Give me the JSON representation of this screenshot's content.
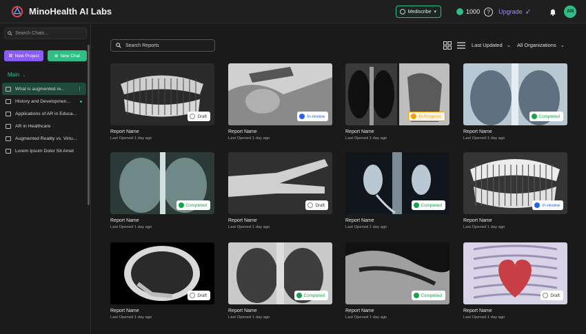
{
  "app": {
    "title": "MinoHealth AI Labs"
  },
  "topbar": {
    "product": "Mediscribe",
    "credits": "1000",
    "help": "?",
    "upgrade": "Upgrade",
    "avatar": "AN"
  },
  "sidebar": {
    "search_placeholder": "Search Chats...",
    "new_project": "New Project",
    "new_chat": "New Chat",
    "section": "Main",
    "items": [
      {
        "label": "What is augmented re..."
      },
      {
        "label": "History and Developmen..."
      },
      {
        "label": "Applications of AR in Educa..."
      },
      {
        "label": "AR in Healthcare"
      },
      {
        "label": "Augmented Reality vs. Virtu..."
      },
      {
        "label": "Lorem Ipsum Dolor Sit Amet"
      }
    ]
  },
  "toolbar": {
    "search_placeholder": "Search Reports",
    "sort": "Last Updated",
    "org": "All Organizations"
  },
  "status_colors": {
    "Draft": "#888888",
    "In-review": "#2563eb",
    "In-Progress": "#f59e0b",
    "Completed": "#16a34a"
  },
  "reports": [
    {
      "name": "Report Name",
      "opened": "Last Opened 1 day ago",
      "status": "Draft"
    },
    {
      "name": "Report Name",
      "opened": "Last Opened 1 day ago",
      "status": "In-review"
    },
    {
      "name": "Report Name",
      "opened": "Last Opened 1 day ago",
      "status": "In-Progress"
    },
    {
      "name": "Report Name",
      "opened": "Last Opened 1 day ago",
      "status": "Completed"
    },
    {
      "name": "Report Name",
      "opened": "Last Opened 1 day ago",
      "status": "Completed"
    },
    {
      "name": "Report Name",
      "opened": "Last Opened 1 day ago",
      "status": "Draft"
    },
    {
      "name": "Report Name",
      "opened": "Last Opened 1 day ago",
      "status": "Completed"
    },
    {
      "name": "Report Name",
      "opened": "Last Opened 1 day ago",
      "status": "In-review"
    },
    {
      "name": "Report Name",
      "opened": "Last Opened 1 day ago",
      "status": "Draft"
    },
    {
      "name": "Report Name",
      "opened": "Last Opened 1 day ago",
      "status": "Completed"
    },
    {
      "name": "Report Name",
      "opened": "Last Opened 1 day ago",
      "status": "Completed"
    },
    {
      "name": "Report Name",
      "opened": "Last Opened 1 day ago",
      "status": "Draft"
    }
  ]
}
